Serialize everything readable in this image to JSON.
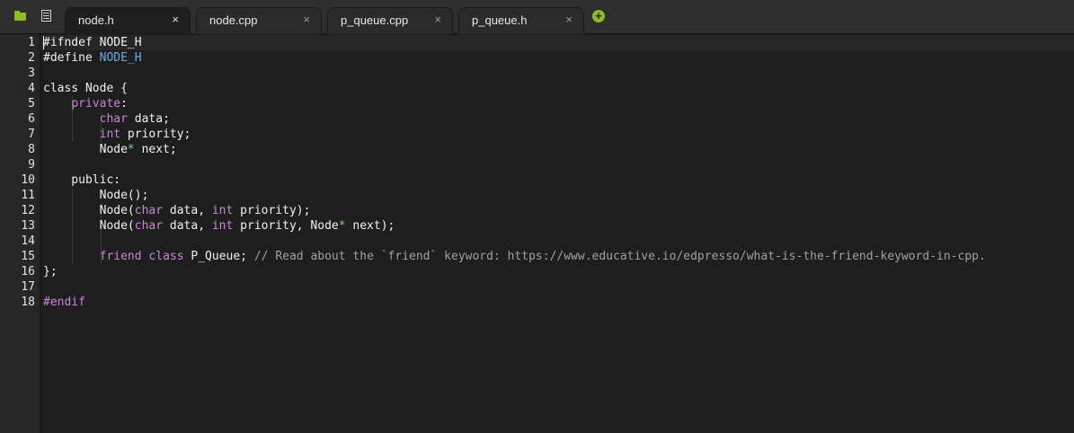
{
  "toolbar": {
    "folder_icon": "folder-icon",
    "filelist_icon": "file-list-icon",
    "add_tab_icon": "plus-circle-icon"
  },
  "tabs": [
    {
      "label": "node.h",
      "close": "×",
      "active": true
    },
    {
      "label": "node.cpp",
      "close": "×",
      "active": false
    },
    {
      "label": "p_queue.cpp",
      "close": "×",
      "active": false
    },
    {
      "label": "p_queue.h",
      "close": "×",
      "active": false
    }
  ],
  "add_tab_label": "+",
  "colors": {
    "keyword": "#c786d3",
    "macro": "#6fa6e6",
    "operator": "#7fcf8c",
    "comment": "#a0a0a0",
    "accent": "#8dbb22"
  },
  "line_numbers": [
    "1",
    "2",
    "3",
    "4",
    "5",
    "6",
    "7",
    "8",
    "9",
    "10",
    "11",
    "12",
    "13",
    "14",
    "15",
    "16",
    "17",
    "18"
  ],
  "code": [
    [
      {
        "t": "#ifndef NODE_H",
        "c": ""
      }
    ],
    [
      {
        "t": "#define ",
        "c": ""
      },
      {
        "t": "NODE_H",
        "c": "mac"
      }
    ],
    [],
    [
      {
        "t": "class Node {",
        "c": ""
      }
    ],
    [
      {
        "t": "    ",
        "c": ""
      },
      {
        "t": "private",
        "c": "kw"
      },
      {
        "t": ":",
        "c": ""
      }
    ],
    [
      {
        "t": "        ",
        "c": ""
      },
      {
        "t": "char",
        "c": "kw"
      },
      {
        "t": " data;",
        "c": ""
      }
    ],
    [
      {
        "t": "        ",
        "c": ""
      },
      {
        "t": "int",
        "c": "kw"
      },
      {
        "t": " priority;",
        "c": ""
      }
    ],
    [
      {
        "t": "        Node",
        "c": ""
      },
      {
        "t": "*",
        "c": "op"
      },
      {
        "t": " next;",
        "c": ""
      }
    ],
    [],
    [
      {
        "t": "    public:",
        "c": ""
      }
    ],
    [
      {
        "t": "        Node();",
        "c": ""
      }
    ],
    [
      {
        "t": "        Node(",
        "c": ""
      },
      {
        "t": "char",
        "c": "kw"
      },
      {
        "t": " data, ",
        "c": ""
      },
      {
        "t": "int",
        "c": "kw"
      },
      {
        "t": " priority);",
        "c": ""
      }
    ],
    [
      {
        "t": "        Node(",
        "c": ""
      },
      {
        "t": "char",
        "c": "kw"
      },
      {
        "t": " data, ",
        "c": ""
      },
      {
        "t": "int",
        "c": "kw"
      },
      {
        "t": " priority, Node",
        "c": ""
      },
      {
        "t": "*",
        "c": "op"
      },
      {
        "t": " next);",
        "c": ""
      }
    ],
    [],
    [
      {
        "t": "        ",
        "c": ""
      },
      {
        "t": "friend",
        "c": "kw"
      },
      {
        "t": " ",
        "c": ""
      },
      {
        "t": "class",
        "c": "kw"
      },
      {
        "t": " P_Queue; ",
        "c": ""
      },
      {
        "t": "// Read about the `friend` keyword: https://www.educative.io/edpresso/what-is-the-friend-keyword-in-cpp.",
        "c": "cm"
      }
    ],
    [
      {
        "t": "};",
        "c": ""
      }
    ],
    [],
    [
      {
        "t": "#endif",
        "c": "kw"
      }
    ]
  ]
}
